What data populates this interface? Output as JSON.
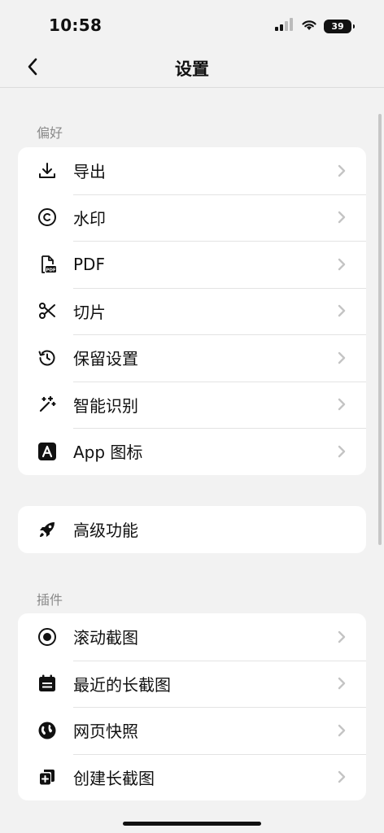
{
  "status": {
    "time": "10:58",
    "battery": "39"
  },
  "nav": {
    "title": "设置"
  },
  "sections": {
    "preferences": {
      "header": "偏好"
    },
    "plugins": {
      "header": "插件"
    }
  },
  "preferences_items": [
    {
      "label": "导出",
      "icon": "download-icon"
    },
    {
      "label": "水印",
      "icon": "copyright-icon"
    },
    {
      "label": "PDF",
      "icon": "pdf-file-icon"
    },
    {
      "label": "切片",
      "icon": "scissors-icon"
    },
    {
      "label": "保留设置",
      "icon": "history-icon"
    },
    {
      "label": "智能识别",
      "icon": "magic-wand-icon"
    },
    {
      "label": "App 图标",
      "icon": "app-letter-icon"
    }
  ],
  "advanced": {
    "label": "高级功能",
    "icon": "rocket-icon"
  },
  "plugins_items": [
    {
      "label": "滚动截图",
      "icon": "record-icon"
    },
    {
      "label": "最近的长截图",
      "icon": "calendar-list-icon"
    },
    {
      "label": "网页快照",
      "icon": "globe-icon"
    },
    {
      "label": "创建长截图",
      "icon": "add-stack-icon"
    }
  ],
  "colors": {
    "background": "#f2f2f2",
    "card": "#ffffff",
    "chevron": "#c4c4c4",
    "section_header": "#8a8a8a"
  }
}
